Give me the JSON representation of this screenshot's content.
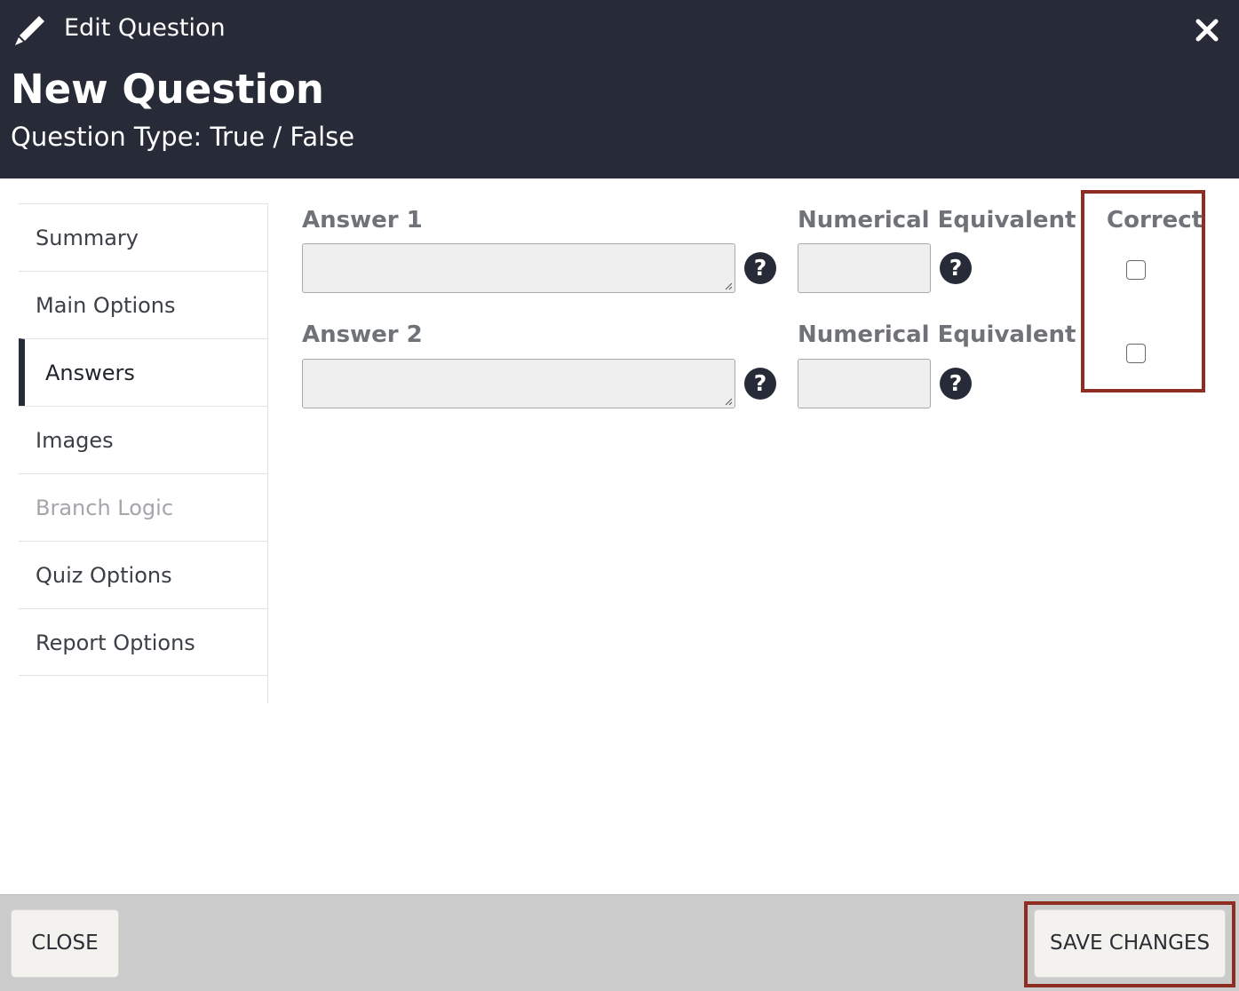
{
  "header": {
    "dialog_title": "Edit Question",
    "question_title": "New Question",
    "question_type": "Question Type: True / False",
    "icons": {
      "edit": "pencil-icon",
      "close": "close-icon"
    }
  },
  "sidebar": {
    "items": [
      {
        "label": "Summary",
        "state": "normal"
      },
      {
        "label": "Main Options",
        "state": "normal"
      },
      {
        "label": "Answers",
        "state": "active"
      },
      {
        "label": "Images",
        "state": "normal"
      },
      {
        "label": "Branch Logic",
        "state": "disabled"
      },
      {
        "label": "Quiz Options",
        "state": "normal"
      },
      {
        "label": "Report Options",
        "state": "normal"
      }
    ]
  },
  "answers": {
    "correct_label": "Correct",
    "rows": [
      {
        "label": "Answer 1",
        "value": "",
        "numerical_label": "Numerical Equivalent",
        "numerical_value": "",
        "correct": false
      },
      {
        "label": "Answer 2",
        "value": "",
        "numerical_label": "Numerical Equivalent",
        "numerical_value": "",
        "correct": false
      }
    ],
    "help_glyph": "?"
  },
  "footer": {
    "close_label": "CLOSE",
    "save_label": "SAVE CHANGES"
  },
  "colors": {
    "header_bg": "#272b38",
    "footer_bg": "#cbcbcb",
    "highlight": "#8e2e22",
    "input_bg": "#efefef"
  }
}
